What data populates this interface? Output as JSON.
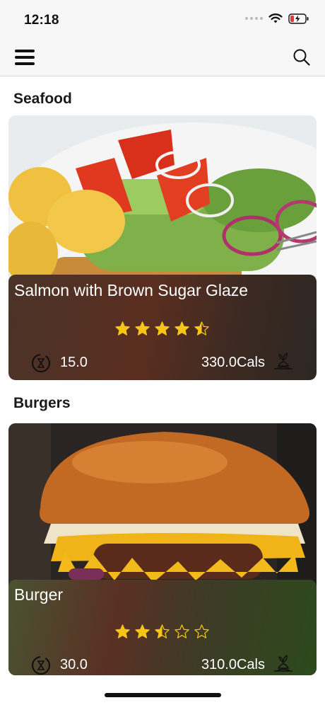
{
  "status_bar": {
    "time": "12:18"
  },
  "nav": {
    "menu_icon": "hamburger-icon",
    "search_icon": "search-icon"
  },
  "sections": [
    {
      "title": "Seafood",
      "recipe": {
        "name": "Salmon with Brown Sugar Glaze",
        "rating": 4.5,
        "time": "15.0",
        "calories": "330.0Cals"
      }
    },
    {
      "title": "Burgers",
      "recipe": {
        "name": "Burger",
        "rating": 2.5,
        "time": "30.0",
        "calories": "310.0Cals"
      }
    }
  ],
  "colors": {
    "star": "#f5c518",
    "overlay_dark": "#3a2418",
    "overlay_green": "#2c4a1c"
  }
}
